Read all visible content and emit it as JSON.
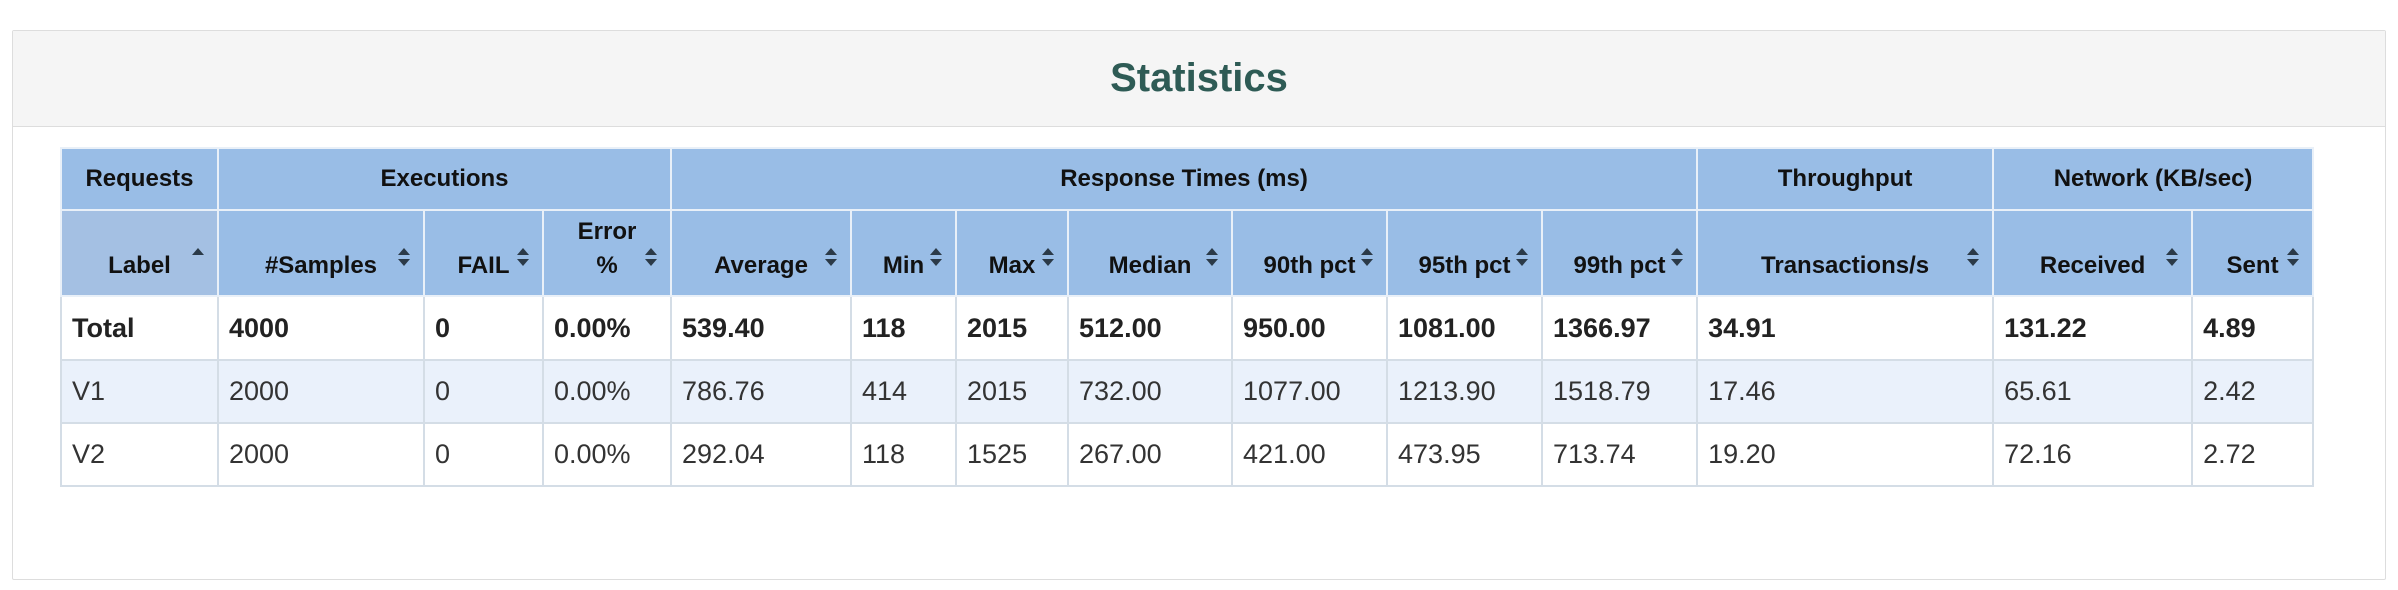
{
  "panel": {
    "title": "Statistics"
  },
  "table": {
    "groups": [
      {
        "label": "Requests",
        "span": 1
      },
      {
        "label": "Executions",
        "span": 3
      },
      {
        "label": "Response Times (ms)",
        "span": 7
      },
      {
        "label": "Throughput",
        "span": 1
      },
      {
        "label": "Network (KB/sec)",
        "span": 2
      }
    ],
    "columns": [
      {
        "label": "Label",
        "sort": "ascending"
      },
      {
        "label": "#Samples",
        "sort": "both"
      },
      {
        "label": "FAIL",
        "sort": "both"
      },
      {
        "label": "Error %",
        "sort": "both"
      },
      {
        "label": "Average",
        "sort": "both"
      },
      {
        "label": "Min",
        "sort": "both"
      },
      {
        "label": "Max",
        "sort": "both"
      },
      {
        "label": "Median",
        "sort": "both"
      },
      {
        "label": "90th pct",
        "sort": "both"
      },
      {
        "label": "95th pct",
        "sort": "both"
      },
      {
        "label": "99th pct",
        "sort": "both"
      },
      {
        "label": "Transactions/s",
        "sort": "both"
      },
      {
        "label": "Received",
        "sort": "both"
      },
      {
        "label": "Sent",
        "sort": "both"
      }
    ],
    "total": [
      "Total",
      "4000",
      "0",
      "0.00%",
      "539.40",
      "118",
      "2015",
      "512.00",
      "950.00",
      "1081.00",
      "1366.97",
      "34.91",
      "131.22",
      "4.89"
    ],
    "rows": [
      [
        "V1",
        "2000",
        "0",
        "0.00%",
        "786.76",
        "414",
        "2015",
        "732.00",
        "1077.00",
        "1213.90",
        "1518.79",
        "17.46",
        "65.61",
        "2.42"
      ],
      [
        "V2",
        "2000",
        "0",
        "0.00%",
        "292.04",
        "118",
        "1525",
        "267.00",
        "421.00",
        "473.95",
        "713.74",
        "19.20",
        "72.16",
        "2.72"
      ]
    ]
  },
  "icons": {
    "sort_ascending": "sort-ascending-icon",
    "sort_both": "sort-both-icon"
  },
  "colors": {
    "header_bg": "#99bde6",
    "title": "#2e5b55",
    "row_alt": "#eaf1fb"
  }
}
